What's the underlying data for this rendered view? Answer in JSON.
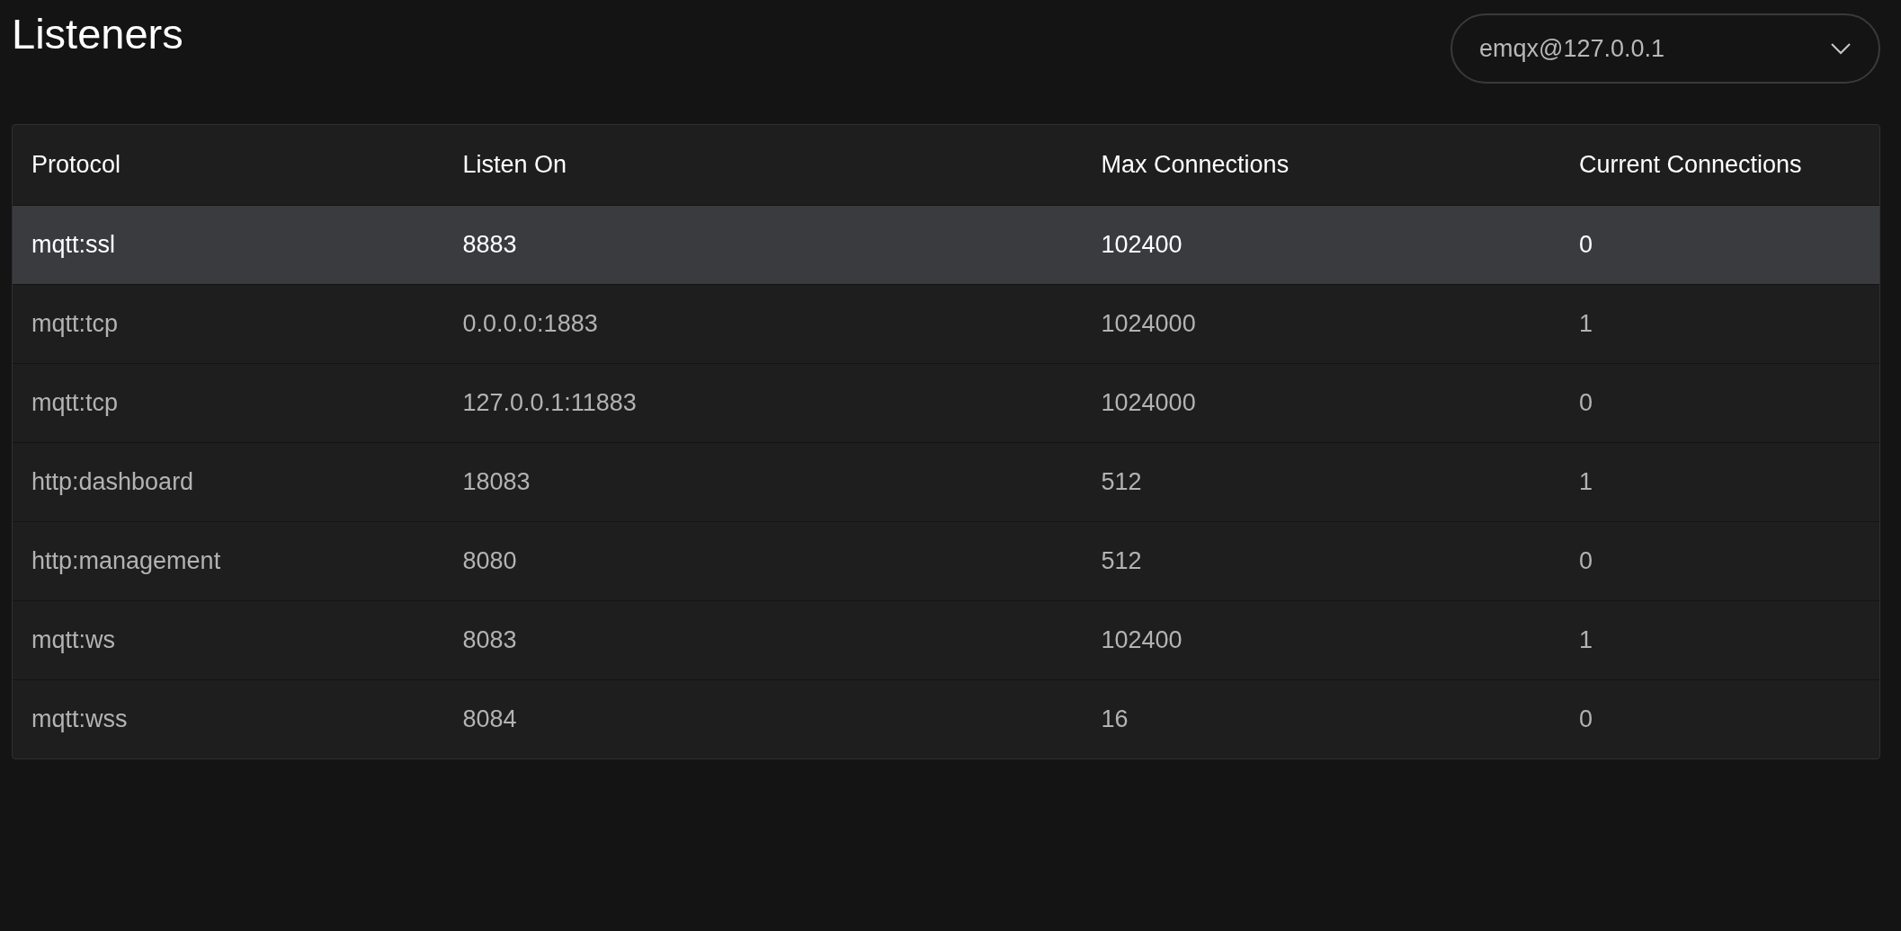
{
  "title": "Listeners",
  "node_select": {
    "value": "emqx@127.0.0.1"
  },
  "table": {
    "columns": [
      "Protocol",
      "Listen On",
      "Max Connections",
      "Current Connections"
    ],
    "rows": [
      {
        "cells": [
          "mqtt:ssl",
          "8883",
          "102400",
          "0"
        ],
        "selected": true
      },
      {
        "cells": [
          "mqtt:tcp",
          "0.0.0.0:1883",
          "1024000",
          "1"
        ],
        "selected": false
      },
      {
        "cells": [
          "mqtt:tcp",
          "127.0.0.1:11883",
          "1024000",
          "0"
        ],
        "selected": false
      },
      {
        "cells": [
          "http:dashboard",
          "18083",
          "512",
          "1"
        ],
        "selected": false
      },
      {
        "cells": [
          "http:management",
          "8080",
          "512",
          "0"
        ],
        "selected": false
      },
      {
        "cells": [
          "mqtt:ws",
          "8083",
          "102400",
          "1"
        ],
        "selected": false
      },
      {
        "cells": [
          "mqtt:wss",
          "8084",
          "16",
          "0"
        ],
        "selected": false
      }
    ]
  }
}
